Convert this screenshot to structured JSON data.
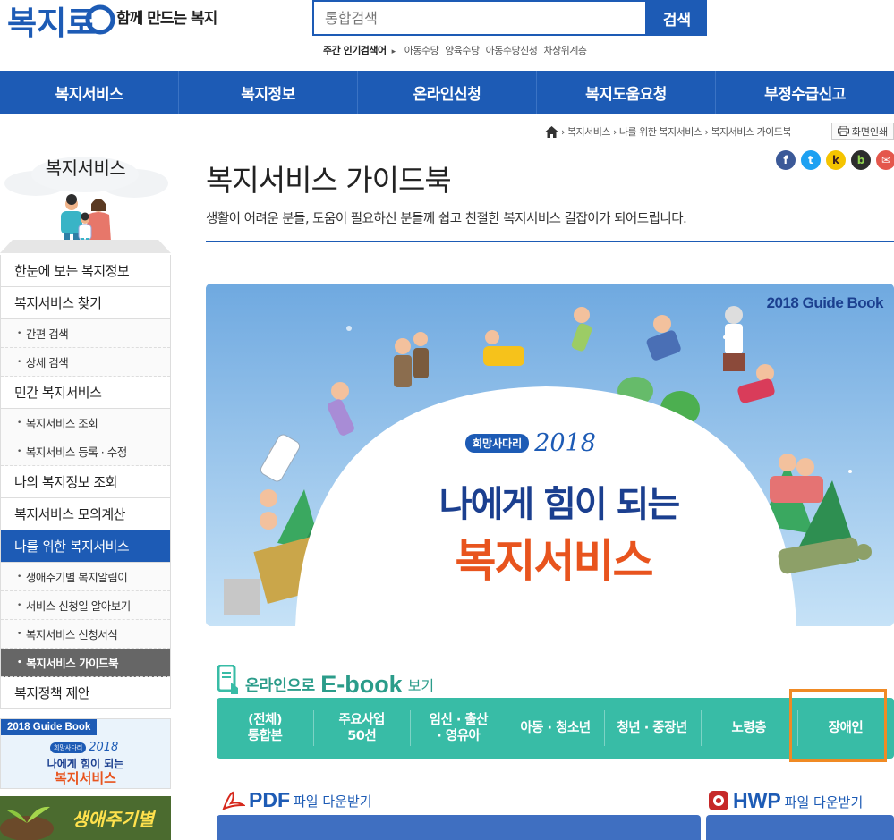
{
  "header": {
    "logo_text": "복지로",
    "tagline": "함께 만드는 복지",
    "search_placeholder": "통합검색",
    "search_button": "검색",
    "popular_label": "주간 인기검색어",
    "popular_keywords": [
      "아동수당",
      "양육수당",
      "아동수당신청",
      "차상위계층"
    ]
  },
  "gnb": [
    "복지서비스",
    "복지정보",
    "온라인신청",
    "복지도움요청",
    "부정수급신고"
  ],
  "breadcrumb": [
    "복지서비스",
    "나를 위한 복지서비스",
    "복지서비스 가이드북"
  ],
  "print_label": "화면인쇄",
  "sidebar": {
    "title": "복지서비스",
    "menu": [
      {
        "label": "한눈에 보는 복지정보",
        "type": "main"
      },
      {
        "label": "복지서비스 찾기",
        "type": "main"
      },
      {
        "label": "간편 검색",
        "type": "sub"
      },
      {
        "label": "상세 검색",
        "type": "sub"
      },
      {
        "label": "민간 복지서비스",
        "type": "main"
      },
      {
        "label": "복지서비스 조회",
        "type": "sub"
      },
      {
        "label": "복지서비스 등록 · 수정",
        "type": "sub"
      },
      {
        "label": "나의 복지정보 조회",
        "type": "main"
      },
      {
        "label": "복지서비스 모의계산",
        "type": "main"
      },
      {
        "label": "나를 위한 복지서비스",
        "type": "main",
        "active": true
      },
      {
        "label": "생애주기별 복지알림이",
        "type": "sub"
      },
      {
        "label": "서비스 신청일 알아보기",
        "type": "sub"
      },
      {
        "label": "복지서비스 신청서식",
        "type": "sub"
      },
      {
        "label": "복지서비스 가이드북",
        "type": "sub",
        "active": true
      },
      {
        "label": "복지정책 제안",
        "type": "main"
      }
    ],
    "banner1": {
      "tag": "2018 Guide Book",
      "badge": "희망사다리",
      "year": "2018",
      "line1": "나에게 힘이 되는",
      "line2": "복지서비스"
    },
    "banner2": {
      "text": "생애주기별"
    }
  },
  "content": {
    "title": "복지서비스 가이드북",
    "intro": "생활이 어려운 분들, 도움이 필요하신 분들께 쉽고 친절한 복지서비스 길잡이가 되어드립니다.",
    "social": [
      "f",
      "t",
      "k",
      "b",
      "✉"
    ],
    "hero": {
      "corner": "2018 Guide Book",
      "badge": "희망사다리",
      "year": "2018",
      "line1": "나에게 힘이 되는",
      "line2": "복지서비스"
    },
    "ebook": {
      "head_a": "온라인으로",
      "head_b": "E-book",
      "head_c": "보기",
      "items": [
        "(전체)\n통합본",
        "주요사업\n50선",
        "임신 · 출산\n· 영유아",
        "아동 · 청소년",
        "청년 · 중장년",
        "노령층",
        "장애인"
      ]
    },
    "pdf": {
      "label_a": "PDF",
      "label_b": "파일 다운받기"
    },
    "hwp": {
      "label_a": "HWP",
      "label_b": "파일 다운받기"
    }
  },
  "colors": {
    "brand": "#1d5bb5",
    "ebook": "#38bca6",
    "highlight": "#f08a24",
    "hero_orange": "#e8541e"
  }
}
